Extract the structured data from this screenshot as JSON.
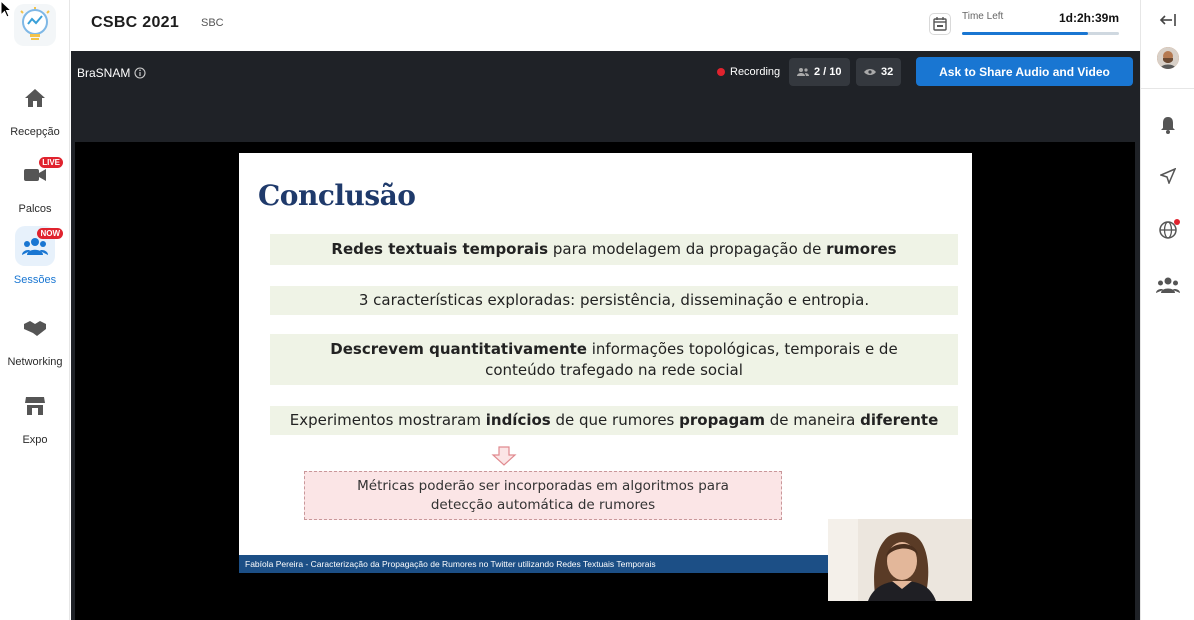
{
  "nav": {
    "items": [
      {
        "label": "Recepção",
        "icon": "home-icon",
        "badge": ""
      },
      {
        "label": "Palcos",
        "icon": "video-camera-icon",
        "badge": "LIVE"
      },
      {
        "label": "Sessões",
        "icon": "people-group-icon",
        "badge": "NOW"
      },
      {
        "label": "Networking",
        "icon": "handshake-icon",
        "badge": ""
      },
      {
        "label": "Expo",
        "icon": "store-icon",
        "badge": ""
      }
    ]
  },
  "header": {
    "title": "CSBC 2021",
    "org": "SBC",
    "time_left_label": "Time Left",
    "time_left_value": "1d:2h:39m",
    "time_progress": 0.8
  },
  "stage": {
    "name": "BraSNAM",
    "recording_label": "Recording",
    "participants": "2 / 10",
    "viewers": "32",
    "ask_button": "Ask to Share Audio and Video"
  },
  "slide": {
    "title": "Conclusão",
    "row1": {
      "b1": "Redes textuais temporais",
      "t1": " para modelagem da propagação de ",
      "b2": "rumores"
    },
    "row2": "3 características exploradas: persistência, disseminação e entropia.",
    "row3": {
      "b1": "Descrevem quantitativamente",
      "t1": " informações topológicas, temporais e de conteúdo trafegado na rede social"
    },
    "row4": {
      "t1": "Experimentos mostraram ",
      "b1": "indícios",
      "t2": " de que rumores ",
      "b2": "propagam",
      "t3": " de maneira ",
      "b3": "diferente"
    },
    "box": "Métricas poderão ser incorporadas em algoritmos para detecção automática de rumores",
    "footer": "Fabíola Pereira - Caracterização da Propagação de Rumores no Twitter utilizando Redes Textuais Temporais"
  },
  "colors": {
    "accent": "#1976d2",
    "live": "#e0232e",
    "stage_bg": "#1f2227"
  }
}
